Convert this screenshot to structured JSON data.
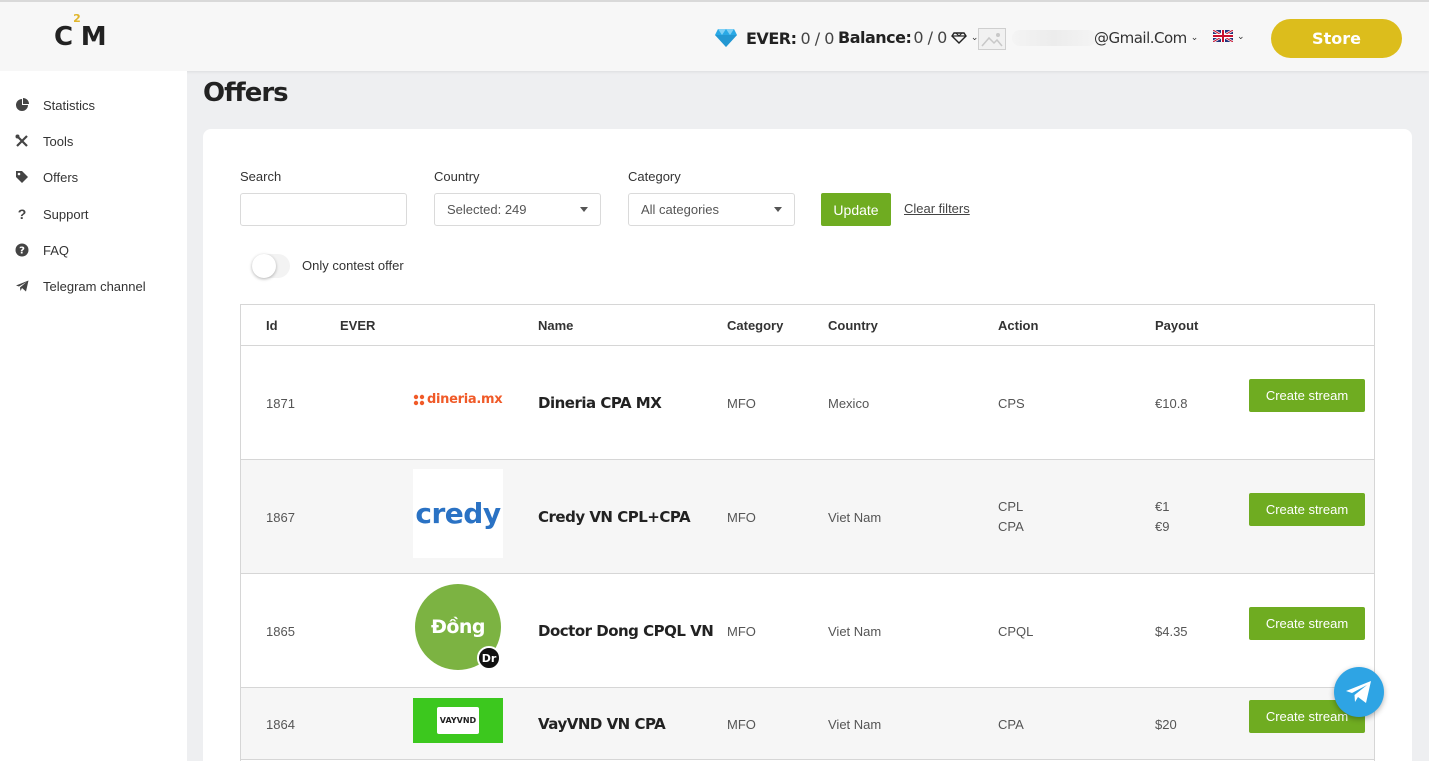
{
  "header": {
    "logo_text": "C",
    "logo_sup": "2",
    "logo_text2": "M",
    "ever_label": "EVER:",
    "ever_value": "0 / 0",
    "balance_label": "Balance:",
    "balance_value": "0 / 0",
    "email": "@Gmail.Com",
    "store_label": "Store"
  },
  "sidebar": {
    "items": [
      {
        "label": "Statistics",
        "icon": "pie-chart-icon"
      },
      {
        "label": "Tools",
        "icon": "tools-icon"
      },
      {
        "label": "Offers",
        "icon": "tag-icon"
      },
      {
        "label": "Support",
        "icon": "question-icon"
      },
      {
        "label": "FAQ",
        "icon": "question-circle-icon"
      },
      {
        "label": "Telegram channel",
        "icon": "telegram-icon"
      }
    ]
  },
  "page": {
    "title": "Offers"
  },
  "filters": {
    "search_label": "Search",
    "search_value": "",
    "country_label": "Country",
    "country_value": "Selected: 249",
    "category_label": "Category",
    "category_value": "All categories",
    "update_label": "Update",
    "clear_label": "Clear filters",
    "toggle_label": "Only contest offer"
  },
  "table": {
    "headers": [
      "Id",
      "EVER",
      "Name",
      "Category",
      "Country",
      "Action",
      "Payout"
    ],
    "rows": [
      {
        "id": "1871",
        "logo": "dineria.mx",
        "name": "Dineria CPA MX",
        "category": "MFO",
        "country": "Mexico",
        "action1": "CPS",
        "action2": "",
        "payout1": "€10.8",
        "payout2": "",
        "button": "Create stream"
      },
      {
        "id": "1867",
        "logo": "credy",
        "name": "Credy VN CPL+CPA",
        "category": "MFO",
        "country": "Viet Nam",
        "action1": "CPL",
        "action2": "CPA",
        "payout1": "€1",
        "payout2": "€9",
        "button": "Create stream"
      },
      {
        "id": "1865",
        "logo": "Đồng",
        "logo_badge": "Dr",
        "name": "Doctor Dong CPQL VN",
        "category": "MFO",
        "country": "Viet Nam",
        "action1": "CPQL",
        "action2": "",
        "payout1": "$4.35",
        "payout2": "",
        "button": "Create stream"
      },
      {
        "id": "1864",
        "logo": "VAYVND",
        "name": "VayVND VN CPA",
        "category": "MFO",
        "country": "Viet Nam",
        "action1": "CPA",
        "action2": "",
        "payout1": "$20",
        "payout2": "",
        "button": "Create stream"
      }
    ]
  },
  "colors": {
    "accent_green": "#6fac21",
    "store_yellow": "#dcbd1c",
    "telegram_blue": "#2ea4e4"
  }
}
